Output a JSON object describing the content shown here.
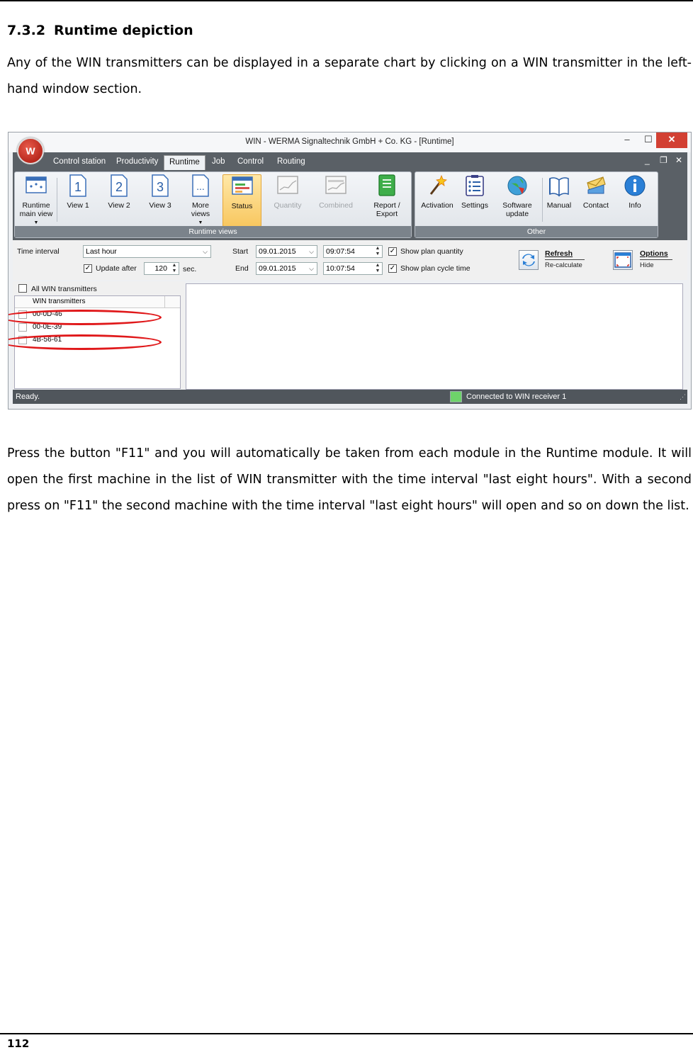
{
  "section": {
    "number": "7.3.2",
    "title": "Runtime depiction"
  },
  "intro_text": "Any of the WIN transmitters can be displayed in a separate chart by clicking on a WIN transmitter in the left-hand window section.",
  "body_text": "Press the button \"F11\" and you will automatically be taken from each module in the Runtime module. It will open the first machine in the list of WIN transmitter with the time interval \"last eight hours\". With a second press on \"F11\" the second machine with the time interval \"last eight hours\" will open and so on down the list.",
  "page_number": "112",
  "screenshot": {
    "window_title": "WIN - WERMA Signaltechnik GmbH + Co. KG - [Runtime]",
    "window_buttons": {
      "minimize": "–",
      "maximize": "☐",
      "close": "✕"
    },
    "mdi_buttons": {
      "minimize": "_",
      "restore": "❐",
      "close": "✕"
    },
    "menu_tabs": [
      "Control station",
      "Productivity",
      "Runtime",
      "Job",
      "Control",
      "Routing"
    ],
    "active_tab": "Runtime",
    "runtime_views": {
      "label": "Runtime views",
      "buttons": [
        {
          "label": "Runtime main view",
          "icon": "runtime-main-view-icon",
          "dropdown": true
        },
        {
          "label": "View 1",
          "icon": "view-1-icon",
          "glyph": "1"
        },
        {
          "label": "View 2",
          "icon": "view-2-icon",
          "glyph": "2"
        },
        {
          "label": "View 3",
          "icon": "view-3-icon",
          "glyph": "3"
        },
        {
          "label": "More views",
          "icon": "more-views-icon",
          "glyph": "...",
          "dropdown": true
        },
        {
          "label": "Status",
          "icon": "status-icon",
          "active": true
        },
        {
          "label": "Quantity",
          "icon": "quantity-icon",
          "disabled": true
        },
        {
          "label": "Combined",
          "icon": "combined-icon",
          "disabled": true
        },
        {
          "label": "Report / Export",
          "icon": "report-export-icon"
        }
      ]
    },
    "other": {
      "label": "Other",
      "buttons": [
        {
          "label": "Activation",
          "icon": "activation-wand-icon"
        },
        {
          "label": "Settings",
          "icon": "settings-checklist-icon"
        },
        {
          "label": "Software update",
          "icon": "software-update-globe-icon"
        },
        {
          "label": "Manual",
          "icon": "manual-book-icon"
        },
        {
          "label": "Contact",
          "icon": "contact-envelope-icon"
        },
        {
          "label": "Info",
          "icon": "info-icon"
        }
      ]
    },
    "controls": {
      "time_interval_label": "Time interval",
      "time_interval_value": "Last hour",
      "update_after_label": "Update after",
      "update_after_checked": true,
      "update_after_value": "120",
      "update_unit": "sec.",
      "start_label": "Start",
      "start_date": "09.01.2015",
      "start_time": "09:07:54",
      "end_label": "End",
      "end_date": "09.01.2015",
      "end_time": "10:07:54",
      "show_plan_quantity_label": "Show plan quantity",
      "show_plan_quantity_checked": true,
      "show_plan_cycle_time_label": "Show plan cycle time",
      "show_plan_cycle_time_checked": true,
      "refresh_label": "Refresh",
      "refresh_sub": "Re-calculate",
      "options_label": "Options",
      "options_sub": "Hide"
    },
    "transmitters": {
      "all_label": "All WIN transmitters",
      "column_header": "WIN transmitters",
      "items": [
        "00-0D-46",
        "00-0E-39",
        "4B-56-61"
      ]
    },
    "statusbar": {
      "left": "Ready.",
      "connection": "Connected to WIN receiver 1"
    },
    "highlight_color": "#e0191b",
    "accent_color": "#f8c760"
  }
}
